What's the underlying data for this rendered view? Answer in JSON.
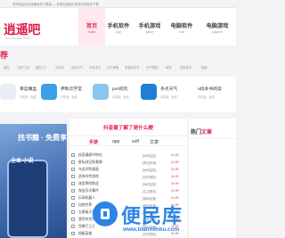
{
  "topbar": {
    "notice": "您好欢迎访问逍遥软件下载站 — 安卓应用软件游戏手机软件下载"
  },
  "logo": {
    "text": "逍遥吧",
    "subtitle": "XIAOYAOBA.COM"
  },
  "nav": [
    {
      "cn": "首页",
      "en": "Index",
      "active": true
    },
    {
      "cn": "手机软件",
      "en": "app",
      "active": false
    },
    {
      "cn": "手机游戏",
      "en": "game",
      "active": false
    },
    {
      "cn": "电脑软件",
      "en": "soft",
      "active": false
    },
    {
      "cn": "电脑游戏",
      "en": "pcgame",
      "active": false
    }
  ],
  "section": {
    "title": "荐"
  },
  "tags": [
    "装扮",
    "实时工具",
    "壁纸工厂",
    "平安年",
    "动态天气",
    "手机定位",
    "打卡神器",
    "录音转文字",
    "天气预报",
    "闹钟",
    "导航助手",
    "指南"
  ],
  "apps": [
    {
      "name": "幸运魔盒",
      "meta": "手机版 · 免费",
      "color": "#e9eef6"
    },
    {
      "name": "伊犁云学堂",
      "meta": "手机版 · 免费",
      "color": "#3aa0e8"
    },
    {
      "name": "pos机玩",
      "meta": "手机版 · 免费",
      "color": "#8ac6f0"
    },
    {
      "name": "多点天气",
      "meta": "手机版 · 免费",
      "color": "#1f7fd6"
    },
    {
      "name": "a找本书阅读",
      "meta": "手机版 · 免费",
      "color": ""
    }
  ],
  "banner": {
    "title": "找书籍 · 免费享",
    "subtitle": "全本 小说"
  },
  "middle": {
    "heading": "抖音最了解了是什么梗",
    "tabs": [
      "手游",
      "app",
      "soft",
      "文章"
    ],
    "rows": [
      {
        "name": "校园漫画中转站",
        "cat": "[休闲益智]",
        "date": "11-09"
      },
      {
        "name": "星际战记急救潮",
        "cat": "[角色扮演]",
        "date": "11-09"
      },
      {
        "name": "乌龙学院漫画",
        "cat": "[休闲益智]",
        "date": "11-09"
      },
      {
        "name": "武林外传游戏",
        "cat": "[动作冒险]",
        "date": "11-09"
      },
      {
        "name": "迷宫探险挑战",
        "cat": "[休闲益智]",
        "date": "11-09"
      },
      {
        "name": "淘宝历次事件",
        "cat": "[生活服务]",
        "date": "11-09"
      },
      {
        "name": "乐高机器人",
        "cat": "[模拟经营]",
        "date": "11-09"
      },
      {
        "name": "仙侠世界",
        "cat": "[角色扮演]",
        "date": "11-09"
      },
      {
        "name": "五星级天堂",
        "cat": "[休闲益智]",
        "date": "11-09"
      },
      {
        "name": "冒险的世界",
        "cat": "[动作冒险]",
        "date": "11-09"
      },
      {
        "name": "完美打工王",
        "cat": "[模拟经营]",
        "date": "11-09"
      },
      {
        "name": "超级英雄",
        "cat": "[动作冒险]",
        "date": "11-09"
      }
    ]
  },
  "watermark": {
    "text": "便民库",
    "url": "www.bianminku.com"
  },
  "hot": {
    "title_black": "热门",
    "title_red": "文章"
  }
}
